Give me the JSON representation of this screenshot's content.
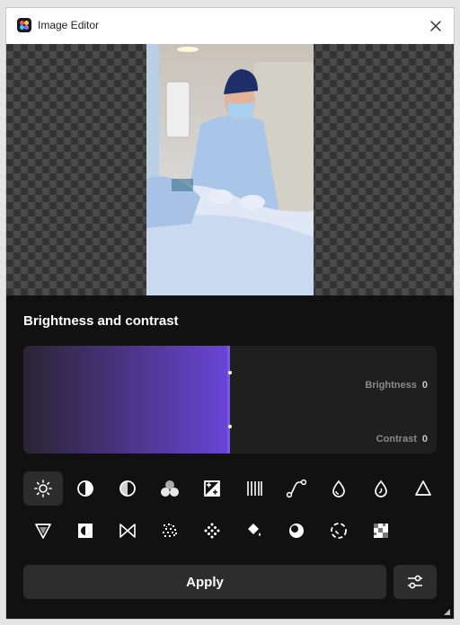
{
  "window": {
    "title": "Image Editor"
  },
  "panel": {
    "title": "Brightness and contrast",
    "brightness": {
      "label": "Brightness",
      "value": "0",
      "level_percent": 50
    },
    "contrast": {
      "label": "Contrast",
      "value": "0",
      "level_percent": 50
    }
  },
  "tools": [
    {
      "icon": "brightness-sun-icon",
      "selected": true
    },
    {
      "icon": "contrast-circle-icon"
    },
    {
      "icon": "half-circle-icon"
    },
    {
      "icon": "color-channels-icon"
    },
    {
      "icon": "exposure-icon"
    },
    {
      "icon": "vertical-lines-icon"
    },
    {
      "icon": "curves-icon"
    },
    {
      "icon": "drop-icon"
    },
    {
      "icon": "drop-swirl-icon"
    },
    {
      "icon": "triangle-icon"
    },
    {
      "icon": "gradient-triangle-icon"
    },
    {
      "icon": "invert-square-icon"
    },
    {
      "icon": "bowtie-icon"
    },
    {
      "icon": "noise-icon"
    },
    {
      "icon": "dither-icon"
    },
    {
      "icon": "paint-bucket-icon"
    },
    {
      "icon": "vignette-icon"
    },
    {
      "icon": "dashed-circle-icon"
    },
    {
      "icon": "pixelate-icon"
    }
  ],
  "actions": {
    "apply_label": "Apply",
    "settings_icon": "sliders-icon"
  },
  "colors": {
    "accent": "#7d52ff",
    "panel_bg": "#111111"
  }
}
